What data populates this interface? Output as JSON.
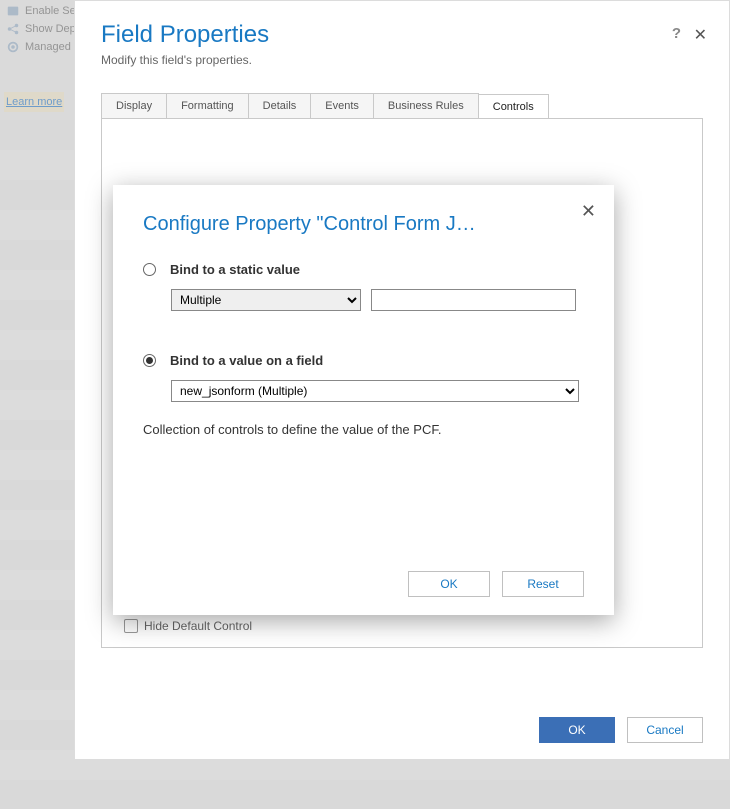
{
  "toolbar": {
    "enable_roles_label": "Enable Security Roles",
    "show_deps_label": "Show Dependencies",
    "managed_label": "Managed"
  },
  "learn_more": "Learn more",
  "main": {
    "title": "Field Properties",
    "subtitle": "Modify this field's properties.",
    "tabs": [
      "Display",
      "Formatting",
      "Details",
      "Events",
      "Business Rules",
      "Controls"
    ],
    "hide_default_label": "Hide Default Control",
    "ok_label": "OK",
    "cancel_label": "Cancel"
  },
  "inner": {
    "title": "Configure Property \"Control Form J…",
    "radio_static_label": "Bind to a static value",
    "static_type_selected": "Multiple",
    "static_value": "",
    "radio_field_label": "Bind to a value on a field",
    "field_selected": "new_jsonform (Multiple)",
    "description": "Collection of controls to define the value of the PCF.",
    "ok_label": "OK",
    "reset_label": "Reset"
  }
}
